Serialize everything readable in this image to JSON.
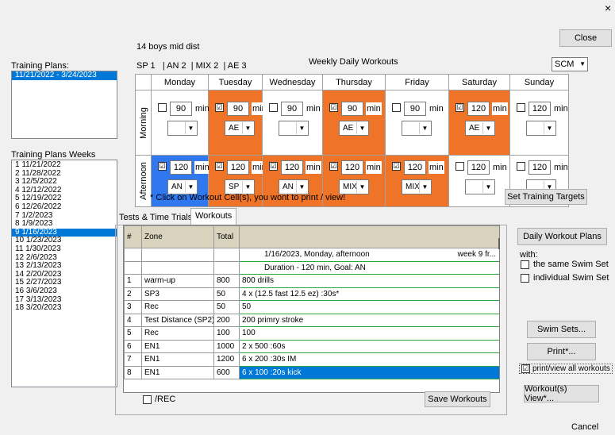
{
  "window": {
    "close_glyph": "×"
  },
  "group_title": "14 boys mid dist",
  "summary": "SP 1   | AN 2  | MIX 2  | AE 3",
  "weekly_title": "Weekly Daily Workouts",
  "pool_select": "SCM",
  "close_button": "Close",
  "training_plans_label": "Training Plans:",
  "training_plans": [
    "11/21/2022 - 3/24/2023"
  ],
  "weeks_label": "Training Plans Weeks",
  "weeks": [
    "1 11/21/2022",
    "2 11/28/2022",
    "3 12/5/2022",
    "4 12/12/2022",
    "5 12/19/2022",
    "6 12/26/2022",
    "7 1/2/2023",
    "8 1/9/2023",
    "9 1/16/2023",
    "10 1/23/2023",
    "11 1/30/2023",
    "12 2/6/2023",
    "13 2/13/2023",
    "14 2/20/2023",
    "15 2/27/2023",
    "16 3/6/2023",
    "17 3/13/2023",
    "18 3/20/2023"
  ],
  "selected_week_index": 8,
  "days": [
    "Monday",
    "Tuesday",
    "Wednesday",
    "Thursday",
    "Friday",
    "Saturday",
    "Sunday"
  ],
  "row_labels": {
    "morning": "Morning",
    "afternoon": "Afternoon"
  },
  "unit": "min",
  "checked_glyph": "☑",
  "dropdown_arrow": "▼",
  "morning": [
    {
      "checked": false,
      "minutes": "90",
      "zone": "",
      "color": "white"
    },
    {
      "checked": true,
      "minutes": "90",
      "zone": "AE",
      "color": "orange"
    },
    {
      "checked": false,
      "minutes": "90",
      "zone": "",
      "color": "white"
    },
    {
      "checked": true,
      "minutes": "90",
      "zone": "AE",
      "color": "orange"
    },
    {
      "checked": false,
      "minutes": "90",
      "zone": "",
      "color": "white"
    },
    {
      "checked": true,
      "minutes": "120",
      "zone": "AE",
      "color": "orange"
    },
    {
      "checked": false,
      "minutes": "120",
      "zone": "",
      "color": "white"
    }
  ],
  "afternoon": [
    {
      "checked": true,
      "minutes": "120",
      "zone": "AN",
      "color": "blue"
    },
    {
      "checked": true,
      "minutes": "120",
      "zone": "SP",
      "color": "orange"
    },
    {
      "checked": true,
      "minutes": "120",
      "zone": "AN",
      "color": "orange"
    },
    {
      "checked": true,
      "minutes": "120",
      "zone": "MIX",
      "color": "orange"
    },
    {
      "checked": true,
      "minutes": "120",
      "zone": "MIX",
      "color": "orange"
    },
    {
      "checked": false,
      "minutes": "120",
      "zone": "",
      "color": "white"
    },
    {
      "checked": false,
      "minutes": "120",
      "zone": "",
      "color": "white"
    }
  ],
  "colors": {
    "orange": "#f07428",
    "blue": "#2f78f0",
    "selection": "#0078d7"
  },
  "hint": "* Click on Workout Cell(s),  you wont to print / view!",
  "set_targets_button": "Set Training Targets",
  "tabs": [
    "Tests & Time Trials",
    "Workouts"
  ],
  "grid": {
    "headers": [
      "#",
      "Zone",
      "Total",
      ""
    ],
    "info1": "1/16/2023, Monday, afternoon",
    "info1_right": "week 9 fr...",
    "info2": "Duration - 120 min,   Goal: AN",
    "rows": [
      {
        "n": "1",
        "zone": "warm-up",
        "total": "800",
        "desc": "800 drills"
      },
      {
        "n": "2",
        "zone": "SP3",
        "total": "50",
        "desc": "4 x (12.5 fast 12.5 ez) :30s*"
      },
      {
        "n": "3",
        "zone": "Rec",
        "total": "50",
        "desc": "50"
      },
      {
        "n": "4",
        "zone": "Test Distance (SP2)",
        "total": "200",
        "desc": "200 primry stroke"
      },
      {
        "n": "5",
        "zone": "Rec",
        "total": "100",
        "desc": "100"
      },
      {
        "n": "6",
        "zone": "EN1",
        "total": "1000",
        "desc": "2 x 500 :60s"
      },
      {
        "n": "7",
        "zone": "EN1",
        "total": "1200",
        "desc": "6 x 200 :30s IM"
      },
      {
        "n": "8",
        "zone": "EN1",
        "total": "600",
        "desc": "6 x 100 :20s kick"
      }
    ]
  },
  "rec_checkbox": "/REC",
  "save_workouts_button": "Save Workouts",
  "daily_workout_plans_button": "Daily Workout Plans",
  "with_label": "with:",
  "same_swim_set": "the same Swim Set",
  "individual_swim_set": "individual Swim Set",
  "swim_sets_button": "Swim Sets...",
  "print_button": "Print*...",
  "print_all": "print/view all workouts",
  "workouts_view_button": "Workout(s) View*...",
  "cancel_button": "Cancel"
}
